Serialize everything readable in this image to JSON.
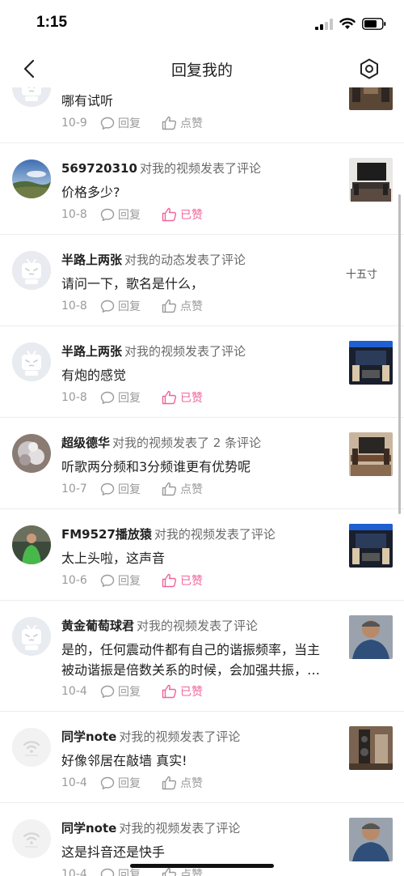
{
  "status_bar": {
    "time": "1:15"
  },
  "header": {
    "title": "回复我的",
    "back_icon": "chevron-left-icon",
    "settings_icon": "hexagon-gear-icon"
  },
  "labels": {
    "reply": "回复",
    "like": "点赞",
    "liked": "已赞"
  },
  "colors": {
    "liked_pink": "#f0649a",
    "meta_gray": "#9a9a9a"
  },
  "items": [
    {
      "user": "",
      "action": "",
      "content": "哪有试听",
      "date": "10-9",
      "liked": false,
      "avatar": "default",
      "thumb": "stereo",
      "thumb_text": ""
    },
    {
      "user": "569720310",
      "action": "对我的视频发表了评论",
      "content": "价格多少?",
      "date": "10-8",
      "liked": true,
      "avatar": "landscape",
      "thumb": "tv",
      "thumb_text": ""
    },
    {
      "user": "半路上两张",
      "action": "对我的动态发表了评论",
      "content": "请问一下，歌名是什么，",
      "date": "10-8",
      "liked": false,
      "avatar": "default",
      "thumb": "",
      "thumb_text": "十五寸"
    },
    {
      "user": "半路上两张",
      "action": "对我的视频发表了评论",
      "content": "有炮的感觉",
      "date": "10-8",
      "liked": true,
      "avatar": "default",
      "thumb": "stage",
      "thumb_text": ""
    },
    {
      "user": "超级德华",
      "action": "对我的视频发表了 2 条评论",
      "content": "听歌两分频和3分频谁更有优势呢",
      "date": "10-7",
      "liked": false,
      "avatar": "crystal",
      "thumb": "tv-warm",
      "thumb_text": ""
    },
    {
      "user": "FM9527播放猿",
      "action": "对我的视频发表了评论",
      "content": "太上头啦，这声音",
      "date": "10-6",
      "liked": true,
      "avatar": "person",
      "thumb": "stage",
      "thumb_text": ""
    },
    {
      "user": "黄金葡萄球君",
      "action": "对我的视频发表了评论",
      "content": "是的，任何震动件都有自己的谐振频率，当主被动谐振是倍数关系的时候，会加强共振，产生谐波失真",
      "date": "10-4",
      "liked": true,
      "avatar": "default",
      "thumb": "man",
      "thumb_text": ""
    },
    {
      "user": "同学note",
      "action": "对我的视频发表了评论",
      "content": "好像邻居在敲墙 真实!",
      "date": "10-4",
      "liked": false,
      "avatar": "gray",
      "thumb": "speaker",
      "thumb_text": ""
    },
    {
      "user": "同学note",
      "action": "对我的视频发表了评论",
      "content": "这是抖音还是快手",
      "date": "10-4",
      "liked": false,
      "avatar": "gray",
      "thumb": "man",
      "thumb_text": ""
    }
  ]
}
